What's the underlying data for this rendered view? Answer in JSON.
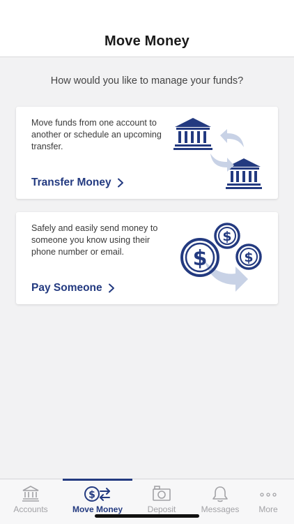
{
  "header": {
    "title": "Move Money"
  },
  "prompt": "How would you like to manage your funds?",
  "cards": [
    {
      "description": "Move funds from one account to another or schedule an upcoming transfer.",
      "action_label": "Transfer Money",
      "illustration": "bank-transfer-icon"
    },
    {
      "description": "Safely and easily send money to someone you know using their phone number or email.",
      "action_label": "Pay Someone",
      "illustration": "dollar-coins-icon"
    }
  ],
  "tabs": [
    {
      "label": "Accounts",
      "icon": "bank-icon",
      "active": false
    },
    {
      "label": "Move Money",
      "icon": "dollar-transfer-icon",
      "active": true
    },
    {
      "label": "Deposit",
      "icon": "camera-icon",
      "active": false
    },
    {
      "label": "Messages",
      "icon": "bell-icon",
      "active": false
    },
    {
      "label": "More",
      "icon": "more-dots-icon",
      "active": false
    }
  ],
  "colors": {
    "accent": "#233a80",
    "arrow_light": "#c8d2e6",
    "inactive": "#a2a2a6",
    "background": "#f2f2f3"
  }
}
